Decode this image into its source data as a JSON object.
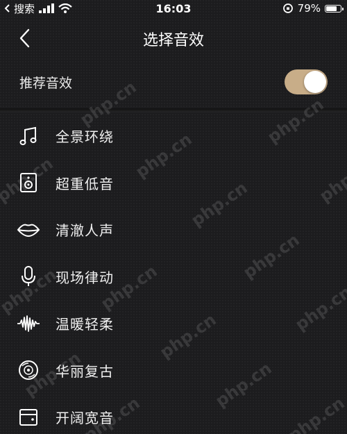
{
  "status_bar": {
    "carrier": "搜索",
    "time": "16:03",
    "battery_percent": "79%",
    "battery_level": 0.79
  },
  "nav": {
    "title": "选择音效",
    "back_icon": "chevron-left-icon"
  },
  "recommend": {
    "label": "推荐音效",
    "enabled": true,
    "toggle_color": "#c8ad88"
  },
  "effects": [
    {
      "label": "全景环绕",
      "icon": "music-note-icon"
    },
    {
      "label": "超重低音",
      "icon": "speaker-icon"
    },
    {
      "label": "清澈人声",
      "icon": "lips-icon"
    },
    {
      "label": "现场律动",
      "icon": "microphone-icon"
    },
    {
      "label": "温暖轻柔",
      "icon": "waveform-icon"
    },
    {
      "label": "华丽复古",
      "icon": "vinyl-record-icon"
    },
    {
      "label": "开阔宽音",
      "icon": "wide-speaker-icon"
    }
  ],
  "watermark": "php.cn"
}
